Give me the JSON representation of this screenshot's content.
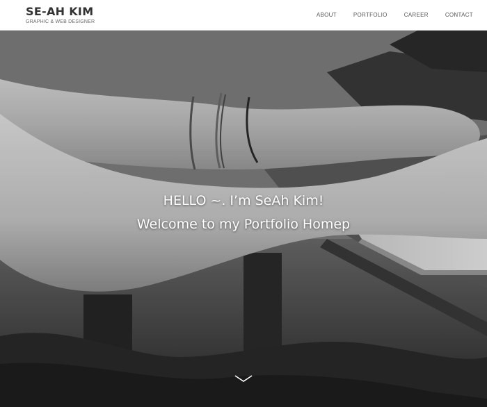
{
  "brand": {
    "name": "SE-AH KIM",
    "subtitle": "GRAPHIC & WEB DESIGNER"
  },
  "nav": {
    "items": [
      {
        "label": "ABOUT"
      },
      {
        "label": "PORTFOLIO"
      },
      {
        "label": "CAREER"
      },
      {
        "label": "CONTACT"
      }
    ]
  },
  "hero": {
    "line1": "HELLO ~.  I’m SeAh Kim!",
    "line2": "Welcome to my Portfolio Homep",
    "background_icon": "typing-hands-photo",
    "scroll_icon": "chevron-down-icon"
  },
  "colors": {
    "header_bg": "#ffffff",
    "brand_text": "#333333",
    "nav_text": "#555555",
    "hero_text": "#ffffff"
  }
}
